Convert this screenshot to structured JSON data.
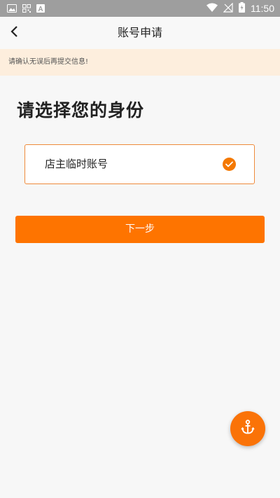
{
  "status_bar": {
    "time": "11:50",
    "left_icons": [
      "image-icon",
      "qr-icon",
      "font-a-icon"
    ],
    "right_icons": [
      "wifi-icon",
      "no-signal-icon",
      "battery-icon"
    ]
  },
  "header": {
    "title": "账号申请",
    "back_icon": "chevron-left-icon"
  },
  "notice": {
    "text": "请确认无误后再提交信息!"
  },
  "main": {
    "heading": "请选择您的身份",
    "options": [
      {
        "label": "店主临时账号",
        "selected": true
      }
    ],
    "next_label": "下一步"
  },
  "fab": {
    "icon": "anchor-icon"
  },
  "colors": {
    "accent": "#fe7400",
    "notice_bg": "#fdeedd",
    "option_border": "#ee8a3a",
    "background": "#f7f7f7"
  }
}
